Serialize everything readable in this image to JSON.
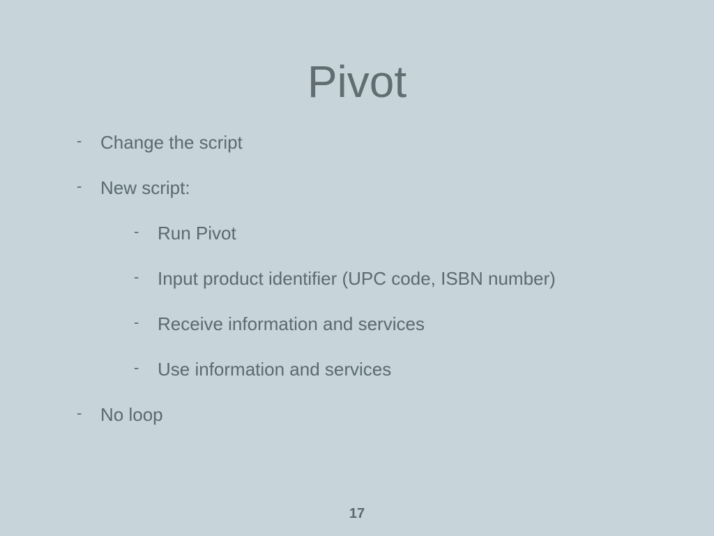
{
  "title": "Pivot",
  "bullets": {
    "b0": "Change the script",
    "b1": "New script:",
    "b2": "No loop"
  },
  "sub": {
    "s0": "Run Pivot",
    "s1": "Input product identifier (UPC code, ISBN number)",
    "s2": "Receive information and services",
    "s3": "Use information and services"
  },
  "page_number": "17"
}
